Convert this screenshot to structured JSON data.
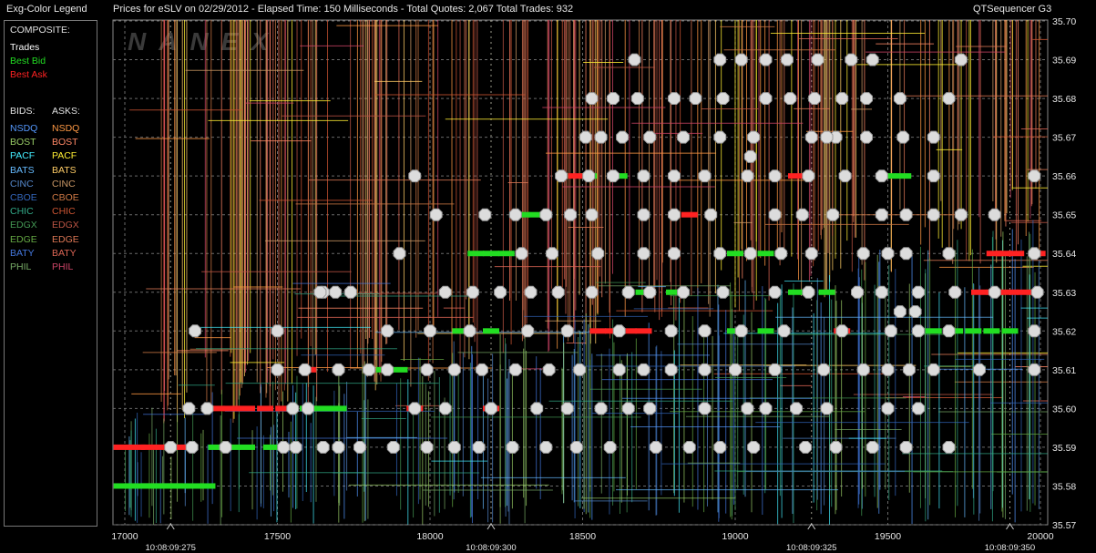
{
  "topbar": {
    "legend_title": "Exg-Color Legend",
    "chart_title": "Prices for  eSLV  on  02/29/2012  -  Elapsed Time: 150 Milliseconds  -  Total Quotes: 2,067  Total Trades: 932",
    "app_name": "QTSequencer G3"
  },
  "watermark": "NANEX",
  "legend": {
    "composite_header": "COMPOSITE:",
    "composite": [
      {
        "label": "Trades",
        "color": "#ffffff"
      },
      {
        "label": "Best Bid",
        "color": "#22dd22"
      },
      {
        "label": "Best Ask",
        "color": "#ff2222"
      }
    ],
    "bids_header": "BIDS:",
    "asks_header": "ASKS:",
    "exchanges": [
      {
        "bid": "NSDQ",
        "ask": "NSDQ",
        "bid_color": "#5599ff",
        "ask_color": "#ff9944"
      },
      {
        "bid": "BOST",
        "ask": "BOST",
        "bid_color": "#99cc66",
        "ask_color": "#ff8866"
      },
      {
        "bid": "PACF",
        "ask": "PACF",
        "bid_color": "#44eeff",
        "ask_color": "#ffee33"
      },
      {
        "bid": "BATS",
        "ask": "BATS",
        "bid_color": "#66bbff",
        "ask_color": "#ffcc66"
      },
      {
        "bid": "CINC",
        "ask": "CINC",
        "bid_color": "#5588cc",
        "ask_color": "#cc9966"
      },
      {
        "bid": "CBOE",
        "ask": "CBOE",
        "bid_color": "#3366bb",
        "ask_color": "#cc7744"
      },
      {
        "bid": "CHIC",
        "ask": "CHIC",
        "bid_color": "#33aa88",
        "ask_color": "#cc5533"
      },
      {
        "bid": "EDGX",
        "ask": "EDGX",
        "bid_color": "#449955",
        "ask_color": "#bb5544"
      },
      {
        "bid": "EDGE",
        "ask": "EDGE",
        "bid_color": "#66aa44",
        "ask_color": "#dd7755"
      },
      {
        "bid": "BATY",
        "ask": "BATY",
        "bid_color": "#4477dd",
        "ask_color": "#dd6655"
      },
      {
        "bid": "PHIL",
        "ask": "PHIL",
        "bid_color": "#77aa66",
        "ask_color": "#cc4466"
      }
    ]
  },
  "chart_data": {
    "type": "scatter",
    "title": "Prices for  eSLV  on  02/29/2012",
    "xlabel": "",
    "ylabel": "",
    "xlim": [
      16950,
      20025
    ],
    "ylim": [
      35.57,
      35.7
    ],
    "x_ticks": [
      "17000",
      "17500",
      "18000",
      "18500",
      "19000",
      "19500",
      "20000"
    ],
    "x_tick_values": [
      17000,
      17500,
      18000,
      18500,
      19000,
      19500,
      20000
    ],
    "time_ticks": [
      {
        "label": "10:08:09:275",
        "x": 17150
      },
      {
        "label": "10:08:09:300",
        "x": 18200
      },
      {
        "label": "10:08:09:325",
        "x": 19250
      },
      {
        "label": "10:08:09:350",
        "x": 19900
      }
    ],
    "y_ticks": [
      "35.57",
      "35.58",
      "35.59",
      "35.60",
      "35.61",
      "35.62",
      "35.63",
      "35.64",
      "35.65",
      "35.66",
      "35.67",
      "35.68",
      "35.69",
      "35.70"
    ],
    "grid": true,
    "series": [
      {
        "name": "Trades",
        "color": "#e0e0e0",
        "points": [
          [
            17230,
            35.62
          ],
          [
            17500,
            35.62
          ],
          [
            17650,
            35.63
          ],
          [
            17740,
            35.63
          ],
          [
            17900,
            35.64
          ],
          [
            18300,
            35.64
          ],
          [
            18400,
            35.64
          ],
          [
            18550,
            35.64
          ],
          [
            18700,
            35.64
          ],
          [
            18800,
            35.64
          ],
          [
            18950,
            35.64
          ],
          [
            19050,
            35.64
          ],
          [
            19150,
            35.64
          ],
          [
            19250,
            35.64
          ],
          [
            19420,
            35.64
          ],
          [
            19500,
            35.64
          ],
          [
            19560,
            35.64
          ],
          [
            19700,
            35.64
          ],
          [
            19980,
            35.64
          ],
          [
            17210,
            35.6
          ],
          [
            17270,
            35.6
          ],
          [
            17550,
            35.6
          ],
          [
            17600,
            35.6
          ],
          [
            17950,
            35.6
          ],
          [
            18050,
            35.6
          ],
          [
            18200,
            35.6
          ],
          [
            18350,
            35.6
          ],
          [
            18450,
            35.6
          ],
          [
            18560,
            35.6
          ],
          [
            18650,
            35.6
          ],
          [
            18720,
            35.6
          ],
          [
            18900,
            35.6
          ],
          [
            19040,
            35.6
          ],
          [
            19100,
            35.6
          ],
          [
            19200,
            35.6
          ],
          [
            19300,
            35.6
          ],
          [
            19500,
            35.6
          ],
          [
            19600,
            35.6
          ],
          [
            17150,
            35.59
          ],
          [
            17220,
            35.59
          ],
          [
            17330,
            35.59
          ],
          [
            17520,
            35.59
          ],
          [
            17560,
            35.59
          ],
          [
            17650,
            35.59
          ],
          [
            17700,
            35.59
          ],
          [
            17770,
            35.59
          ],
          [
            17880,
            35.59
          ],
          [
            17990,
            35.59
          ],
          [
            18080,
            35.59
          ],
          [
            18160,
            35.59
          ],
          [
            18270,
            35.59
          ],
          [
            18380,
            35.59
          ],
          [
            18480,
            35.59
          ],
          [
            18590,
            35.59
          ],
          [
            18740,
            35.59
          ],
          [
            18850,
            35.59
          ],
          [
            18950,
            35.59
          ],
          [
            19060,
            35.59
          ],
          [
            19230,
            35.59
          ],
          [
            19330,
            35.59
          ],
          [
            19450,
            35.59
          ],
          [
            19560,
            35.59
          ],
          [
            19700,
            35.59
          ],
          [
            17500,
            35.61
          ],
          [
            17590,
            35.61
          ],
          [
            17700,
            35.61
          ],
          [
            17800,
            35.61
          ],
          [
            17860,
            35.61
          ],
          [
            17990,
            35.61
          ],
          [
            18080,
            35.61
          ],
          [
            18170,
            35.61
          ],
          [
            18280,
            35.61
          ],
          [
            18390,
            35.61
          ],
          [
            18490,
            35.61
          ],
          [
            18620,
            35.61
          ],
          [
            18700,
            35.61
          ],
          [
            18790,
            35.61
          ],
          [
            18900,
            35.61
          ],
          [
            19000,
            35.61
          ],
          [
            19130,
            35.61
          ],
          [
            19290,
            35.61
          ],
          [
            19420,
            35.61
          ],
          [
            19500,
            35.61
          ],
          [
            19570,
            35.61
          ],
          [
            19650,
            35.61
          ],
          [
            19800,
            35.61
          ],
          [
            19980,
            35.61
          ],
          [
            17860,
            35.62
          ],
          [
            18000,
            35.62
          ],
          [
            18130,
            35.62
          ],
          [
            18320,
            35.62
          ],
          [
            18450,
            35.62
          ],
          [
            18620,
            35.62
          ],
          [
            18790,
            35.62
          ],
          [
            18900,
            35.62
          ],
          [
            19020,
            35.62
          ],
          [
            19160,
            35.62
          ],
          [
            19350,
            35.62
          ],
          [
            19510,
            35.62
          ],
          [
            19600,
            35.62
          ],
          [
            19700,
            35.62
          ],
          [
            19980,
            35.62
          ],
          [
            17640,
            35.63
          ],
          [
            17690,
            35.63
          ],
          [
            18050,
            35.63
          ],
          [
            18140,
            35.63
          ],
          [
            18230,
            35.63
          ],
          [
            18330,
            35.63
          ],
          [
            18420,
            35.63
          ],
          [
            18530,
            35.63
          ],
          [
            18650,
            35.63
          ],
          [
            18720,
            35.63
          ],
          [
            18830,
            35.63
          ],
          [
            18960,
            35.63
          ],
          [
            19130,
            35.63
          ],
          [
            19240,
            35.63
          ],
          [
            19400,
            35.63
          ],
          [
            19480,
            35.63
          ],
          [
            19600,
            35.63
          ],
          [
            19720,
            35.63
          ],
          [
            19850,
            35.63
          ],
          [
            19990,
            35.63
          ],
          [
            18020,
            35.65
          ],
          [
            18180,
            35.65
          ],
          [
            18280,
            35.65
          ],
          [
            18380,
            35.65
          ],
          [
            18460,
            35.65
          ],
          [
            18530,
            35.65
          ],
          [
            18700,
            35.65
          ],
          [
            18800,
            35.65
          ],
          [
            18920,
            35.65
          ],
          [
            19130,
            35.65
          ],
          [
            19220,
            35.65
          ],
          [
            19320,
            35.65
          ],
          [
            19480,
            35.65
          ],
          [
            19560,
            35.65
          ],
          [
            19650,
            35.65
          ],
          [
            19740,
            35.65
          ],
          [
            19850,
            35.65
          ],
          [
            17950,
            35.66
          ],
          [
            18430,
            35.66
          ],
          [
            18520,
            35.66
          ],
          [
            18600,
            35.66
          ],
          [
            18700,
            35.66
          ],
          [
            18800,
            35.66
          ],
          [
            18900,
            35.66
          ],
          [
            19040,
            35.66
          ],
          [
            19130,
            35.66
          ],
          [
            19240,
            35.66
          ],
          [
            19360,
            35.66
          ],
          [
            19480,
            35.66
          ],
          [
            19650,
            35.66
          ],
          [
            19980,
            35.66
          ],
          [
            18510,
            35.67
          ],
          [
            18560,
            35.67
          ],
          [
            18630,
            35.67
          ],
          [
            18720,
            35.67
          ],
          [
            18830,
            35.67
          ],
          [
            18950,
            35.67
          ],
          [
            19060,
            35.67
          ],
          [
            19250,
            35.67
          ],
          [
            19330,
            35.67
          ],
          [
            19430,
            35.67
          ],
          [
            19550,
            35.67
          ],
          [
            19650,
            35.67
          ],
          [
            19050,
            35.665
          ],
          [
            19300,
            35.67
          ],
          [
            18530,
            35.68
          ],
          [
            18600,
            35.68
          ],
          [
            18680,
            35.68
          ],
          [
            18800,
            35.68
          ],
          [
            18870,
            35.68
          ],
          [
            18960,
            35.68
          ],
          [
            19100,
            35.68
          ],
          [
            19180,
            35.68
          ],
          [
            19260,
            35.68
          ],
          [
            19350,
            35.68
          ],
          [
            19430,
            35.68
          ],
          [
            19540,
            35.68
          ],
          [
            19700,
            35.68
          ],
          [
            18670,
            35.69
          ],
          [
            18950,
            35.69
          ],
          [
            19020,
            35.69
          ],
          [
            19100,
            35.69
          ],
          [
            19170,
            35.69
          ],
          [
            19270,
            35.69
          ],
          [
            19380,
            35.69
          ],
          [
            19450,
            35.69
          ],
          [
            19740,
            35.69
          ],
          [
            19540,
            35.625
          ],
          [
            19590,
            35.625
          ]
        ]
      },
      {
        "name": "Best Bid",
        "color": "#22dd22",
        "points": [
          [
            16990,
            35.58
          ],
          [
            17030,
            35.58
          ],
          [
            17080,
            35.58
          ],
          [
            17130,
            35.58
          ],
          [
            17180,
            35.58
          ],
          [
            17230,
            35.58
          ],
          [
            17270,
            35.58
          ],
          [
            17300,
            35.59
          ],
          [
            17350,
            35.59
          ],
          [
            17400,
            35.59
          ],
          [
            17480,
            35.59
          ],
          [
            17600,
            35.6
          ],
          [
            17650,
            35.6
          ],
          [
            17700,
            35.6
          ],
          [
            17900,
            35.61
          ],
          [
            17850,
            35.61
          ],
          [
            18100,
            35.62
          ],
          [
            18200,
            35.62
          ],
          [
            18150,
            35.64
          ],
          [
            18200,
            35.64
          ],
          [
            18250,
            35.64
          ],
          [
            18300,
            35.65
          ],
          [
            18350,
            35.65
          ],
          [
            18520,
            35.66
          ],
          [
            18620,
            35.66
          ],
          [
            19000,
            35.64
          ],
          [
            19100,
            35.64
          ],
          [
            19200,
            35.63
          ],
          [
            19300,
            35.63
          ],
          [
            19500,
            35.66
          ],
          [
            19550,
            35.66
          ],
          [
            19650,
            35.62
          ],
          [
            19720,
            35.62
          ],
          [
            19780,
            35.62
          ],
          [
            19840,
            35.62
          ],
          [
            19900,
            35.62
          ],
          [
            18800,
            35.63
          ],
          [
            18700,
            35.63
          ],
          [
            19000,
            35.62
          ],
          [
            19100,
            35.62
          ]
        ]
      },
      {
        "name": "Best Ask",
        "color": "#ff2222",
        "points": [
          [
            16990,
            35.59
          ],
          [
            17040,
            35.59
          ],
          [
            17080,
            35.59
          ],
          [
            17130,
            35.59
          ],
          [
            17180,
            35.59
          ],
          [
            17300,
            35.6
          ],
          [
            17350,
            35.6
          ],
          [
            17400,
            35.6
          ],
          [
            17460,
            35.6
          ],
          [
            17520,
            35.6
          ],
          [
            17600,
            35.61
          ],
          [
            17950,
            35.6
          ],
          [
            18200,
            35.6
          ],
          [
            18550,
            35.62
          ],
          [
            18600,
            35.62
          ],
          [
            18650,
            35.62
          ],
          [
            18700,
            35.62
          ],
          [
            19350,
            35.62
          ],
          [
            19800,
            35.63
          ],
          [
            19850,
            35.63
          ],
          [
            19900,
            35.63
          ],
          [
            19950,
            35.63
          ],
          [
            19880,
            35.64
          ],
          [
            19920,
            35.64
          ],
          [
            19990,
            35.64
          ],
          [
            19850,
            35.64
          ],
          [
            18850,
            35.65
          ],
          [
            19200,
            35.66
          ],
          [
            18480,
            35.66
          ]
        ]
      }
    ]
  }
}
